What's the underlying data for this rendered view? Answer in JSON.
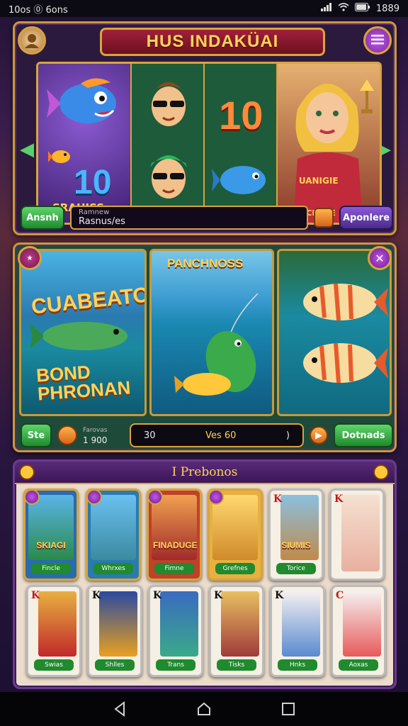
{
  "status_bar": {
    "left_text": "10os ⓪ 6ons",
    "time": "1889"
  },
  "top_panel": {
    "title": "HUS INDAKÜAI",
    "reel1": {
      "number": "10",
      "subtitle": "SRAHISS"
    },
    "reel3": {
      "number": "10"
    },
    "reel4": {
      "shirt_text": "UANIGIE",
      "shirt_text2": "EVRCNEHE"
    },
    "left_button": "Ansnh",
    "field": {
      "placeholder": "Ramnew",
      "value": "Rasnus/es"
    },
    "right_button": "Aponlere"
  },
  "mid_panel": {
    "scene1_title": "CUABEATO",
    "scene1_subtitle_1": "BOND",
    "scene1_subtitle_2": "PHRONAN",
    "scene2_title": "PANCHNOSS",
    "left_button": "Ste",
    "stack_field": {
      "placeholder": "Farovas",
      "value": "1 900"
    },
    "field_left": "30",
    "field_center": "Ves 60",
    "field_right": ")",
    "right_button": "Dotnads"
  },
  "bottom_panel": {
    "title": "I Prebonos",
    "cards_row1": [
      {
        "title": "SKIAGI",
        "label": "Fincle",
        "rank": ""
      },
      {
        "title": "",
        "label": "Whrxes",
        "rank": ""
      },
      {
        "title": "FINADUGE",
        "label": "Fimne",
        "rank": ""
      },
      {
        "title": "",
        "label": "Grefnes",
        "rank": ""
      },
      {
        "title": "SIUMIS",
        "label": "Torice",
        "rank": "K"
      },
      {
        "title": "",
        "label": "",
        "rank": "K"
      }
    ],
    "cards_row2": [
      {
        "label": "Swias",
        "rank": "K"
      },
      {
        "label": "Shlles",
        "rank": "K"
      },
      {
        "label": "Trans",
        "rank": "K"
      },
      {
        "label": "Tisks",
        "rank": "K"
      },
      {
        "label": "Hnks",
        "rank": "K"
      },
      {
        "label": "Aoxas",
        "rank": "C"
      }
    ]
  },
  "colors": {
    "gold": "#d7a43d",
    "green": "#1f8a2e",
    "purple": "#5a2a7a",
    "crimson": "#a0203a"
  },
  "icons": [
    "wifi-icon",
    "signal-icon",
    "battery-icon",
    "menu-icon",
    "back-icon",
    "home-icon",
    "recents-icon"
  ]
}
